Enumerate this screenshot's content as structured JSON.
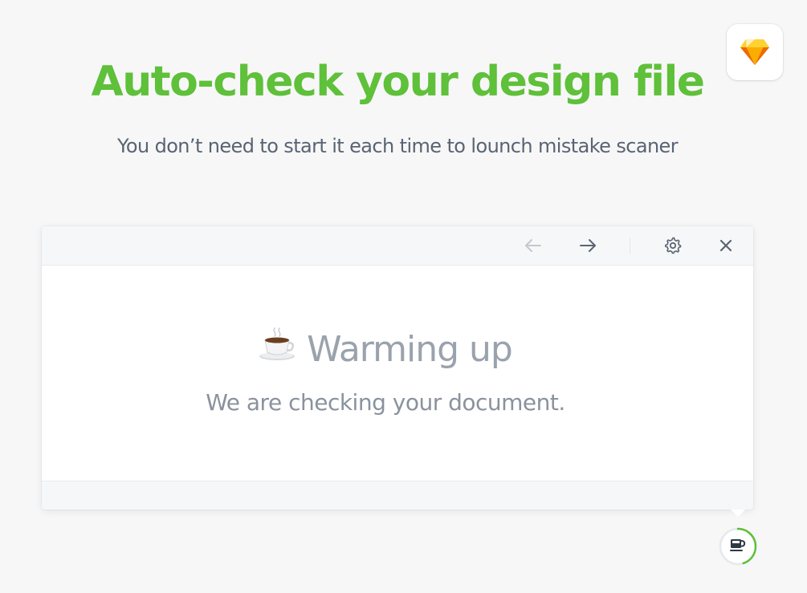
{
  "headline": "Auto-check your design file",
  "subheadline": "You don’t need to start it each time to lounch mistake scaner",
  "app_badge": {
    "icon": "sketch-diamond-icon"
  },
  "toolbar": {
    "back_icon": "arrow-left-icon",
    "forward_icon": "arrow-right-icon",
    "settings_icon": "gear-icon",
    "close_icon": "close-icon"
  },
  "status": {
    "emoji": "☕",
    "title": "Warming up",
    "message": "We are checking your document."
  },
  "progress_indicator": {
    "icon": "coffee-cup-icon",
    "progress": 0.45
  },
  "colors": {
    "accent": "#5fc03a",
    "subtext": "#596473",
    "muted": "#9aa2ad"
  }
}
